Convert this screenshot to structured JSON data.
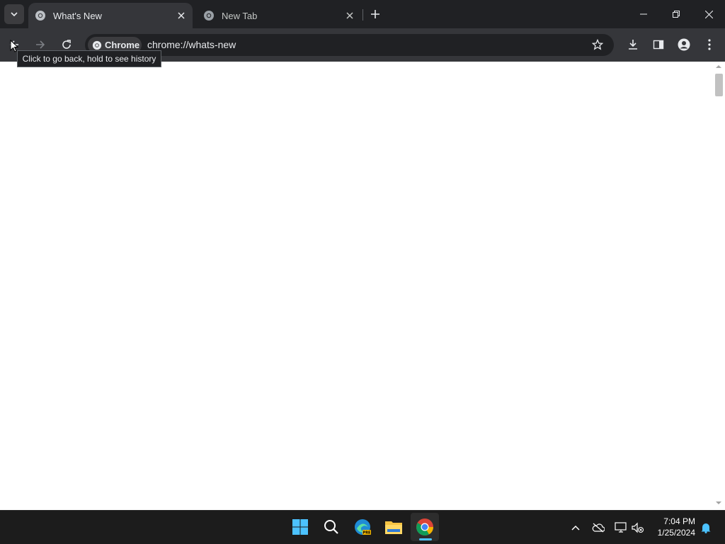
{
  "browser": {
    "tabs": [
      {
        "title": "What's New",
        "active": true,
        "favicon": "chrome-logo-icon"
      },
      {
        "title": "New Tab",
        "active": false,
        "favicon": "chrome-logo-icon"
      }
    ],
    "omnibox": {
      "chip_label": "Chrome",
      "url": "chrome://whats-new"
    },
    "tooltip": "Click to go back, hold to see history"
  },
  "taskbar": {
    "apps": [
      "windows-start-icon",
      "search-icon",
      "edge-icon",
      "file-explorer-icon",
      "chrome-icon"
    ],
    "tray": [
      "chevron-up-icon",
      "onedrive-icon",
      "network-icon",
      "volume-muted-icon",
      "notification-bell-icon"
    ],
    "time": "7:04 PM",
    "date": "1/25/2024"
  },
  "colors": {
    "frame": "#202124",
    "toolbar": "#35363a",
    "page_background": "#ffffff",
    "taskbar": "#1c1c1c",
    "accent": "#4cc2ff"
  }
}
